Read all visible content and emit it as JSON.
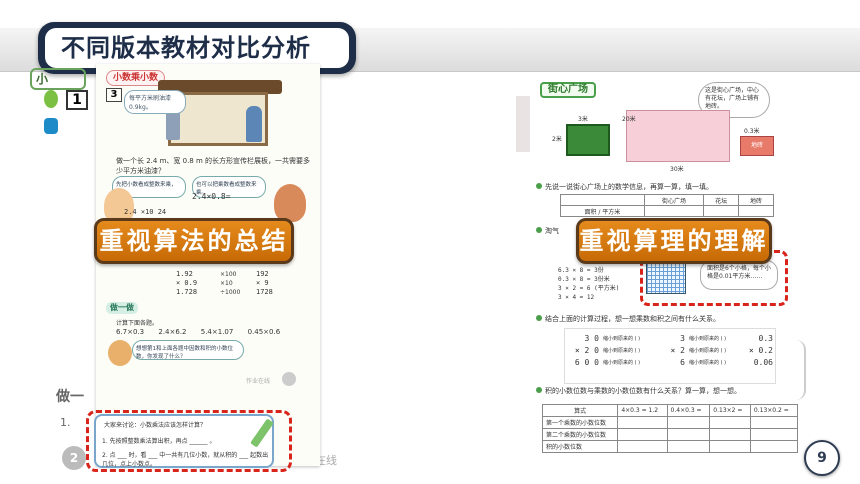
{
  "header": {
    "title": "不同版本教材对比分析"
  },
  "left_page": {
    "lesson_title": "小数乘小数",
    "example_number": "3",
    "bubble_text": "每平方米刷油漆0.9kg。",
    "problem_text": "做一个长 2.4 m、宽 0.8 m 的长方形宣传栏展板，一共需要多少平方米油漆？",
    "hint_left": "先把小数看成整数来乘，再…",
    "hint_right": "也可以把乘数看成整数来乘。",
    "formula": "2.4×0.8=",
    "mid_calc": "2.4 ×10 24",
    "calc_left": [
      "1.92",
      "× 0.9",
      "1.728"
    ],
    "calc_arrows": [
      "×100",
      "×10",
      "÷1000"
    ],
    "calc_right": [
      "192",
      "× 9",
      "1728"
    ],
    "practice_label": "做一做",
    "practice_sub": "计算下面各题。",
    "exercises": [
      "6.7×0.3",
      "2.4×6.2",
      "5.4×1.07",
      "0.45×0.6"
    ],
    "tip_text": "想想第1和上面各题中因数和积的小数位数，你发现了什么？",
    "watermark": "作业在线",
    "summary_title": "大家来讨论：小数乘法应该怎样计算？",
    "summary_line1": "1. 先按照整数乘法算出积，再点 ______ 。",
    "summary_line2": "2. 点 ___ 时，看 ___ 中一共有几位小数，就从积的 ___ 起数出几位，点上小数点。"
  },
  "background_fragments": {
    "tab_text": "小",
    "number_one": "1",
    "practice_text": "做一",
    "item_one": "1.",
    "item_two": "2",
    "watermark": "业在线"
  },
  "right_page": {
    "title": "街心广场",
    "bubble_text": "这是街心广场，中心有花坛，广场上铺有地砖。",
    "dim_garden_w": "3米",
    "dim_garden_h": "2米",
    "dim_plaza_w": "30米",
    "dim_plaza_h": "20米",
    "dim_tile": "0.3米",
    "tile_label": "地砖",
    "q1": "先说一说街心广场上的数学信息，再算一算，填一填。",
    "table1_headers": [
      "",
      "街心广场",
      "花坛",
      "地砖"
    ],
    "table1_row": [
      "面积 / 平方米",
      "",
      "",
      ""
    ],
    "q2": "淘气",
    "steps": [
      "6.3 × 8 = 3份",
      "0.3 × 8 = 3份米",
      "3 × 2 = 6 (平方米)",
      "3 × 4 = 12"
    ],
    "bubble2_text": "面积是6个小格，每个小格是0.01平方米……",
    "q3": "结合上面的计算过程，想一想乘数和积之间有什么关系。",
    "mult_left": [
      "3 0",
      "× 2 0",
      "6 0 0"
    ],
    "mult_mid": [
      "3",
      "× 2",
      "6"
    ],
    "mult_right": [
      "0.3",
      "× 0.2",
      "0.06"
    ],
    "mult_labels": [
      "缩小到原来的 ( )",
      "缩小到原来的 ( )",
      "缩小到原来的 ( )"
    ],
    "q4": "积的小数位数与乘数的小数位数有什么关系？算一算，想一想。",
    "table2_headers": [
      "算式",
      "4×0.3 = 1.2",
      "0.4×0.3 =",
      "0.13×2 =",
      "0.13×0.2 ="
    ],
    "table2_rows": [
      "第一个乘数的小数位数",
      "第二个乘数的小数位数",
      "积的小数位数"
    ]
  },
  "labels": {
    "left_pill": "重视算法的总结",
    "right_pill": "重视算理的理解"
  },
  "page_number": "9",
  "colors": {
    "header_dark": "#1e2e48",
    "pill_orange": "#d97a10",
    "dash_red": "#d8241a"
  }
}
